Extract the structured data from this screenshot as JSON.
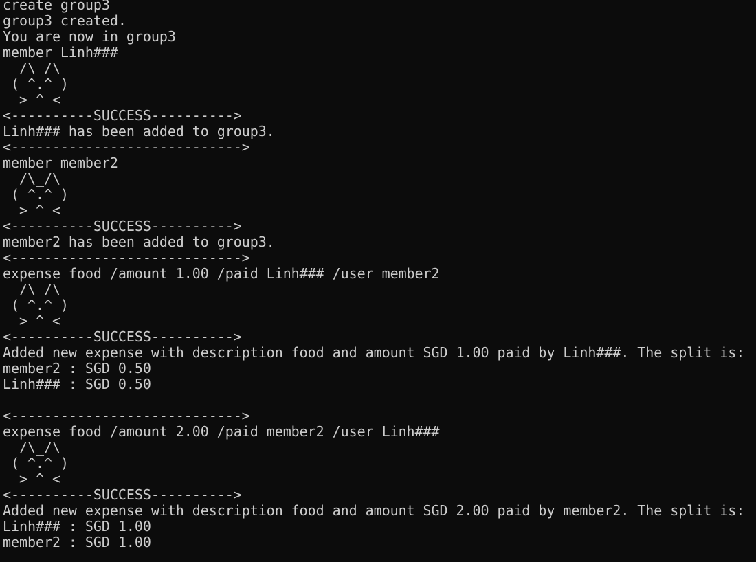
{
  "terminal": {
    "lines": [
      "create group3",
      "group3 created.",
      "You are now in group3",
      "member Linh###",
      "  /\\_/\\",
      " ( ^.^ )",
      "  > ^ <",
      "<----------SUCCESS---------->",
      "Linh### has been added to group3.",
      "<---------------------------->",
      "member member2",
      "  /\\_/\\",
      " ( ^.^ )",
      "  > ^ <",
      "<----------SUCCESS---------->",
      "member2 has been added to group3.",
      "<---------------------------->",
      "expense food /amount 1.00 /paid Linh### /user member2",
      "  /\\_/\\",
      " ( ^.^ )",
      "  > ^ <",
      "<----------SUCCESS---------->",
      "Added new expense with description food and amount SGD 1.00 paid by Linh###. The split is:",
      "member2 : SGD 0.50",
      "Linh### : SGD 0.50",
      "",
      "<---------------------------->",
      "expense food /amount 2.00 /paid member2 /user Linh###",
      "  /\\_/\\",
      " ( ^.^ )",
      "  > ^ <",
      "<----------SUCCESS---------->",
      "Added new expense with description food and amount SGD 2.00 paid by member2. The split is:",
      "Linh### : SGD 1.00",
      "member2 : SGD 1.00"
    ]
  }
}
